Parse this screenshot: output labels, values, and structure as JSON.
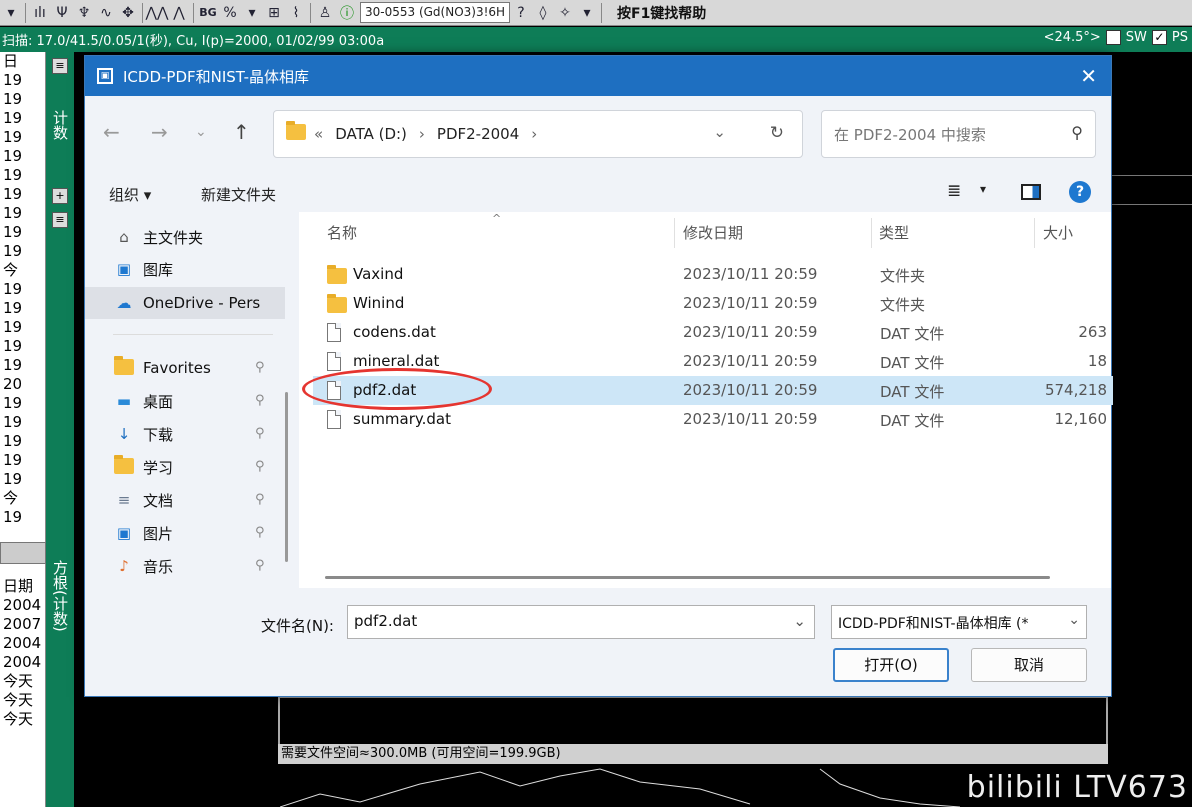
{
  "app": {
    "combo_text": "30-0553 (Gd(NO3)3!6H",
    "help_text": "按F1键找帮助",
    "status_text": "扫描: 17.0/41.5/0.05/1(秒), Cu, I(p)=2000, 01/02/99 03:00a",
    "angle_text": "<24.5°>",
    "sw_label": "SW",
    "ps_label": "PS",
    "side_label_top": "计数",
    "side_label_bottom": "方根(计数)",
    "left_col_top": [
      "日",
      "19",
      "19",
      "19",
      "19",
      "19",
      "19",
      "19",
      "19",
      "19",
      "19",
      "今",
      "19",
      "19",
      "19",
      "19",
      "19",
      "20",
      "19",
      "19",
      "19",
      "19",
      "19",
      "今",
      "19"
    ],
    "left_col_header": "日期",
    "left_col_bottom": [
      "2004",
      "2007",
      "2004",
      "2004",
      "今天",
      "今天",
      "今天"
    ],
    "space_text": "需要文件空间≈300.0MB (可用空间=199.9GB)",
    "watermark": "bilibili LTV673"
  },
  "dialog": {
    "title": "ICDD-PDF和NIST-晶体相库",
    "close": "✕",
    "address": {
      "prefix": "«",
      "crumb1": "DATA (D:)",
      "sep": "›",
      "crumb2": "PDF2-2004",
      "sep2": "›"
    },
    "search_placeholder": "在 PDF2-2004 中搜索",
    "toolbar": {
      "organize": "组织 ▾",
      "new_folder": "新建文件夹"
    },
    "nav": [
      {
        "label": "主文件夹",
        "icon": "⌂"
      },
      {
        "label": "图库",
        "icon": "▣"
      },
      {
        "label": "OneDrive - Pers",
        "icon": "☁"
      },
      {
        "label": "Favorites",
        "icon": ""
      },
      {
        "label": "桌面",
        "icon": "▬"
      },
      {
        "label": "下载",
        "icon": "↓"
      },
      {
        "label": "学习",
        "icon": ""
      },
      {
        "label": "文档",
        "icon": "≡"
      },
      {
        "label": "图片",
        "icon": "▣"
      },
      {
        "label": "音乐",
        "icon": "♪"
      }
    ],
    "columns": {
      "name": "名称",
      "date": "修改日期",
      "type": "类型",
      "size": "大小"
    },
    "files": [
      {
        "name": "Vaxind",
        "date": "2023/10/11 20:59",
        "type": "文件夹",
        "size": "",
        "kind": "folder"
      },
      {
        "name": "Winind",
        "date": "2023/10/11 20:59",
        "type": "文件夹",
        "size": "",
        "kind": "folder"
      },
      {
        "name": "codens.dat",
        "date": "2023/10/11 20:59",
        "type": "DAT 文件",
        "size": "263",
        "kind": "file"
      },
      {
        "name": "mineral.dat",
        "date": "2023/10/11 20:59",
        "type": "DAT 文件",
        "size": "18",
        "kind": "file"
      },
      {
        "name": "pdf2.dat",
        "date": "2023/10/11 20:59",
        "type": "DAT 文件",
        "size": "574,218",
        "kind": "file"
      },
      {
        "name": "summary.dat",
        "date": "2023/10/11 20:59",
        "type": "DAT 文件",
        "size": "12,160",
        "kind": "file"
      }
    ],
    "filename_label": "文件名(N):",
    "filename_value": "pdf2.dat",
    "filetype_value": "ICDD-PDF和NIST-晶体相库 (*",
    "open_button": "打开(O)",
    "cancel_button": "取消"
  }
}
